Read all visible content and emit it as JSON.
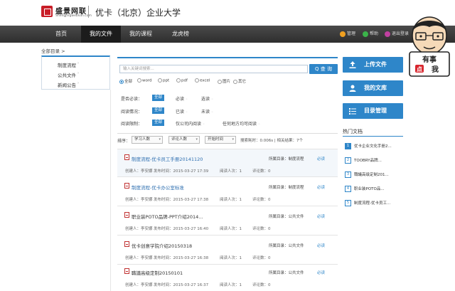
{
  "header": {
    "logo_text": "盛景网联",
    "logo_sub": "Shengjingweblian.com",
    "site_title": "优卡（北京）企业大学"
  },
  "nav": {
    "items": [
      "首页",
      "我的文件",
      "我的课程",
      "龙虎榜"
    ],
    "active_index": 1,
    "right": [
      "管理",
      "帮助",
      "退出登录"
    ],
    "right_colors": [
      "#f0a020",
      "#3bb34a",
      "#c040a0"
    ]
  },
  "breadcrumb": "全部目录 >",
  "sidebar": {
    "items": [
      "制度流程",
      "公共文件",
      "新闻公告"
    ]
  },
  "search": {
    "placeholder": "输入关键词搜索...",
    "button": "Q 查 询"
  },
  "file_types": [
    "全部",
    "word",
    "ppt",
    "pdf",
    "excel",
    "图片",
    "其它"
  ],
  "filters": [
    {
      "label": "是否必读：",
      "options": [
        "全部",
        "必读",
        "选读"
      ]
    },
    {
      "label": "阅读情况：",
      "options": [
        "全部",
        "已读",
        "未读"
      ]
    },
    {
      "label": "阅读限制：",
      "options": [
        "全部",
        "仅公司内阅读",
        "任何地方均可阅读"
      ]
    }
  ],
  "sort": {
    "label": "排序：",
    "buttons": [
      "学习人数",
      "评论人数",
      "开始时间"
    ],
    "info": "搜索耗时：0.006s | 相关结果：7个"
  },
  "documents": [
    {
      "title": "制度流程-优卡员工手册20141120",
      "dir": "所属目录：制度流程",
      "req": "必读",
      "creator": "创建人：李安娜",
      "time": "发布时间：2015-03-27 17:39",
      "reads": "阅读人次：1",
      "comments": "评论数：0",
      "linked": true
    },
    {
      "title": "制度流程-优卡办公室标准",
      "dir": "所属目录：制度流程",
      "req": "必读",
      "creator": "创建人：李安娜",
      "time": "发布时间：2015-03-27 17:38",
      "reads": "阅读人次：1",
      "comments": "评论数：0",
      "linked": true
    },
    {
      "title": "职业装POTO品牌-PPT介绍2014...",
      "dir": "所属目录：公共文件",
      "req": "必读",
      "creator": "创建人：李安娜",
      "time": "发布时间：2015-03-27 16:40",
      "reads": "阅读人次：1",
      "comments": "评论数：0",
      "linked": false
    },
    {
      "title": "优卡创意学院介绍20150318",
      "dir": "所属目录：公共文件",
      "req": "必读",
      "creator": "创建人：李安娜",
      "time": "发布时间：2015-03-27 16:38",
      "reads": "阅读人次：1",
      "comments": "评论数：0",
      "linked": false
    },
    {
      "title": "職議高级定制20150101",
      "dir": "所属目录：公共文件",
      "req": "必读",
      "creator": "创建人：李安娜",
      "time": "发布时间：2015-03-27 16:37",
      "reads": "阅读人次：1",
      "comments": "评论数：0",
      "linked": false
    }
  ],
  "right_buttons": [
    "上传文件",
    "我的文库",
    "目录管理"
  ],
  "hot": {
    "title": "热门文档",
    "items": [
      "优卡企业文化手册2...",
      "TOOBRY品牌...",
      "職議高级定制201...",
      "职业装POTO品...",
      "制度流程-优卡员工..."
    ]
  },
  "avatar": {
    "sign_top": "有事",
    "sign_bottom": "我",
    "badge": "点"
  },
  "colors": {
    "accent": "#2e86c9",
    "nav_bg": "#3a3a3a",
    "logo_red": "#c81e28"
  }
}
